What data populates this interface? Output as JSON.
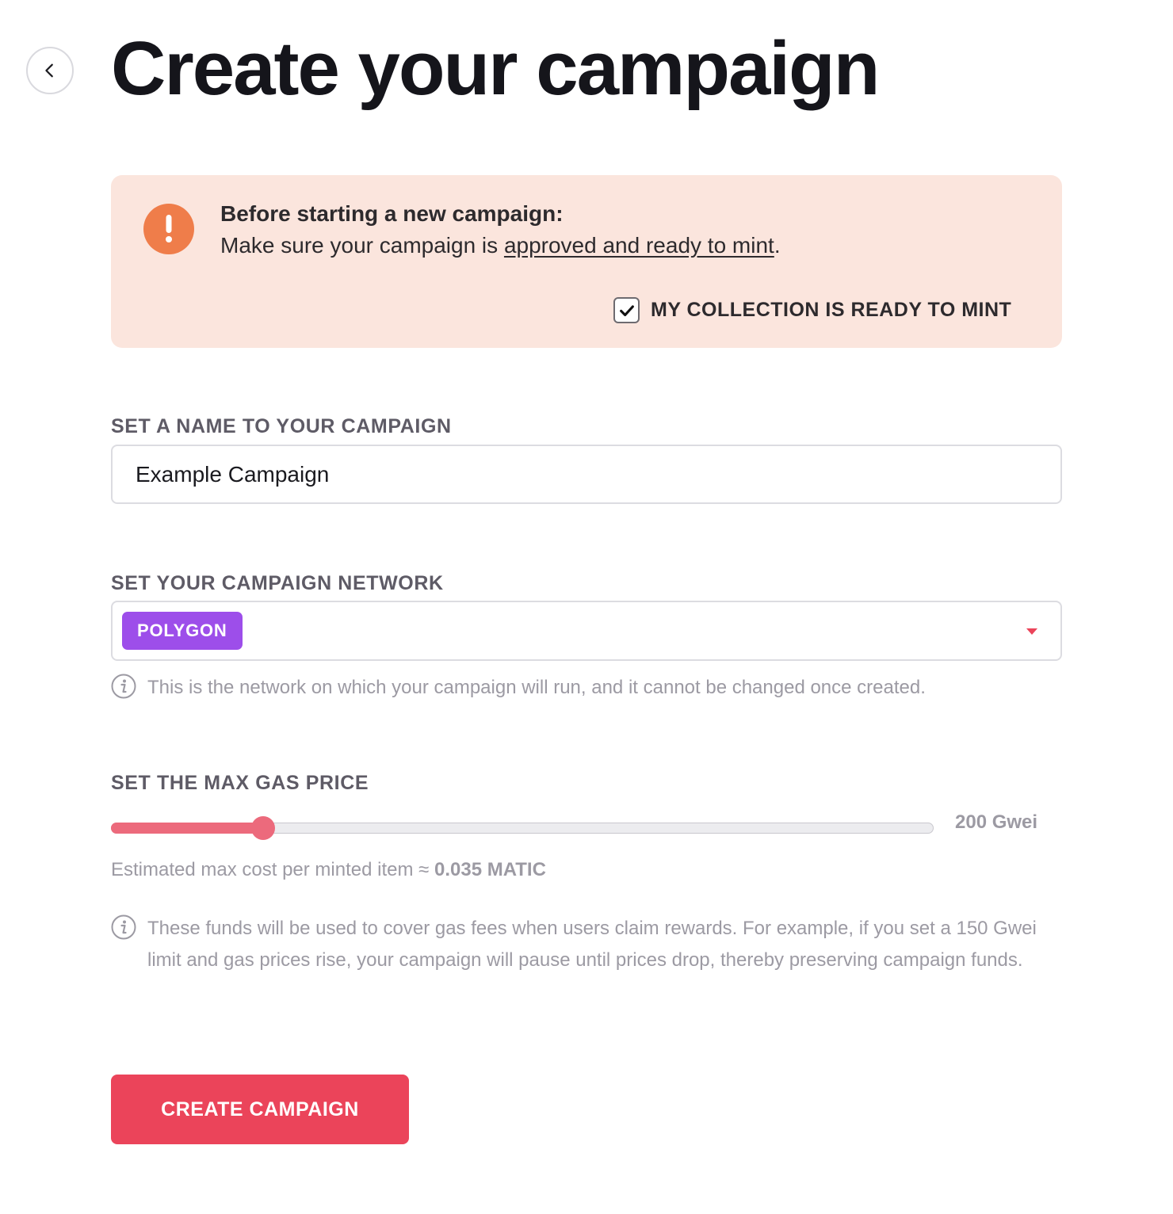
{
  "header": {
    "title": "Create your campaign"
  },
  "warning": {
    "title": "Before starting a new campaign:",
    "text_prefix": "Make sure your campaign is ",
    "link_text": "approved and ready to mint",
    "text_suffix": ".",
    "checkbox_label": "MY COLLECTION IS READY TO MINT",
    "checkbox_checked": true
  },
  "name_section": {
    "label": "SET A NAME TO YOUR CAMPAIGN",
    "value": "Example Campaign"
  },
  "network_section": {
    "label": "SET YOUR CAMPAIGN NETWORK",
    "selected": "POLYGON",
    "info": "This is the network on which your campaign will run, and it cannot be changed once created."
  },
  "gas_section": {
    "label": "SET THE MAX GAS PRICE",
    "slider_fraction": 0.185,
    "value_text": "200 Gwei",
    "estimate_prefix": "Estimated max cost per minted item ≈ ",
    "estimate_value": "0.035 MATIC",
    "info": "These funds will be used to cover gas fees when users claim rewards. For example, if you set a 150 Gwei limit and gas prices rise, your campaign will pause until prices drop, thereby preserving campaign funds."
  },
  "actions": {
    "create_label": "CREATE CAMPAIGN"
  },
  "colors": {
    "accent": "#eb445a",
    "slider": "#ec6a7c",
    "warning_bg": "#fbe5dd",
    "warning_icon": "#ef7d4a",
    "network_tag": "#9d4eea"
  },
  "icons": {
    "back": "chevron-left-icon",
    "warning": "exclamation-icon",
    "check": "checkmark-icon",
    "dropdown": "caret-down-icon",
    "info": "info-icon"
  }
}
